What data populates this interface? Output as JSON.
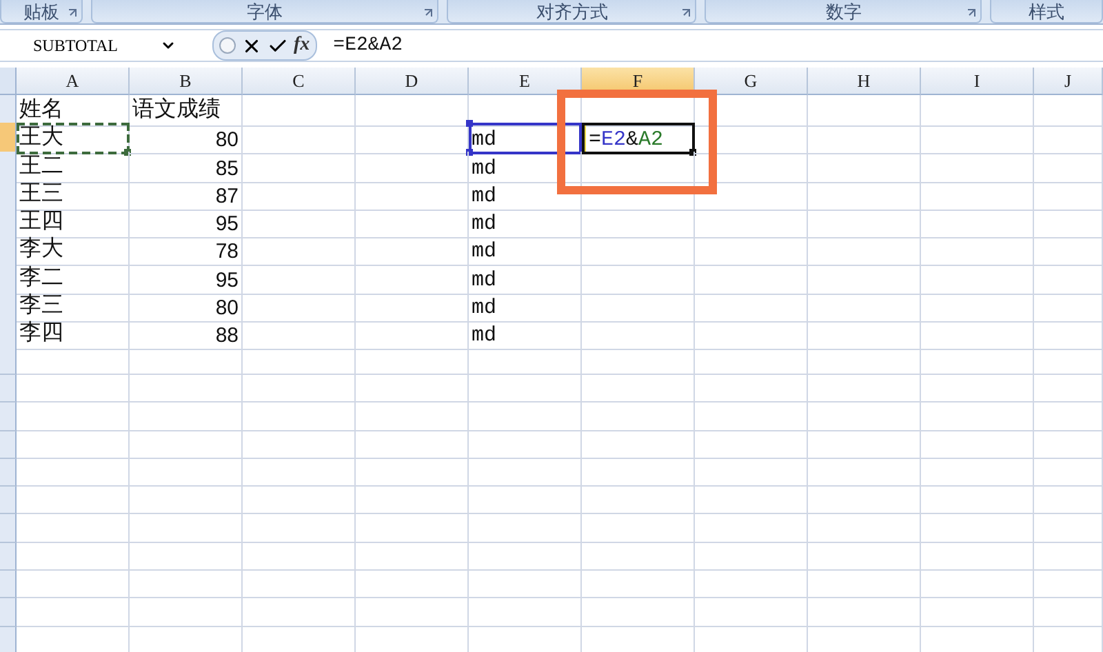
{
  "ribbon_groups": [
    "贴板",
    "字体",
    "对齐方式",
    "数字",
    "样式"
  ],
  "formula_bar": {
    "name_box": "SUBTOTAL",
    "function_button": "fx",
    "formula": "=E2&A2"
  },
  "columns": [
    {
      "label": "A",
      "selected": false
    },
    {
      "label": "B",
      "selected": false
    },
    {
      "label": "C",
      "selected": false
    },
    {
      "label": "D",
      "selected": false
    },
    {
      "label": "E",
      "selected": false
    },
    {
      "label": "F",
      "selected": true
    },
    {
      "label": "G",
      "selected": false
    },
    {
      "label": "H",
      "selected": false
    },
    {
      "label": "I",
      "selected": false
    },
    {
      "label": "J",
      "selected": false
    }
  ],
  "rows": [
    {
      "selected": false,
      "cells": {
        "A": {
          "kind": "text",
          "text": "姓名",
          "copy_marquee": false,
          "reference_box": false
        },
        "B": {
          "kind": "text",
          "text": "语文成绩",
          "copy_marquee": false,
          "reference_box": false
        }
      }
    },
    {
      "selected": true,
      "cells": {
        "A": {
          "kind": "text",
          "text": "王大",
          "copy_marquee": true,
          "reference_box": false
        },
        "B": {
          "kind": "number",
          "text": "80",
          "copy_marquee": false,
          "reference_box": false
        },
        "E": {
          "kind": "code",
          "text": "md",
          "copy_marquee": false,
          "reference_box": true
        },
        "F": {
          "kind": "formula",
          "copy_marquee": false,
          "reference_box": false,
          "parts": [
            {
              "text": "=",
              "color": "#111111"
            },
            {
              "text": "E2",
              "color": "#3535c8"
            },
            {
              "text": "&",
              "color": "#111111"
            },
            {
              "text": "A2",
              "color": "#2a7a2a"
            }
          ]
        }
      }
    },
    {
      "selected": false,
      "cells": {
        "A": {
          "kind": "text",
          "text": "王二",
          "copy_marquee": false,
          "reference_box": false
        },
        "B": {
          "kind": "number",
          "text": "85",
          "copy_marquee": false,
          "reference_box": false
        },
        "E": {
          "kind": "code",
          "text": "md",
          "copy_marquee": false,
          "reference_box": false
        }
      }
    },
    {
      "selected": false,
      "cells": {
        "A": {
          "kind": "text",
          "text": "王三",
          "copy_marquee": false,
          "reference_box": false
        },
        "B": {
          "kind": "number",
          "text": "87",
          "copy_marquee": false,
          "reference_box": false
        },
        "E": {
          "kind": "code",
          "text": "md",
          "copy_marquee": false,
          "reference_box": false
        }
      }
    },
    {
      "selected": false,
      "cells": {
        "A": {
          "kind": "text",
          "text": "王四",
          "copy_marquee": false,
          "reference_box": false
        },
        "B": {
          "kind": "number",
          "text": "95",
          "copy_marquee": false,
          "reference_box": false
        },
        "E": {
          "kind": "code",
          "text": "md",
          "copy_marquee": false,
          "reference_box": false
        }
      }
    },
    {
      "selected": false,
      "cells": {
        "A": {
          "kind": "text",
          "text": "李大",
          "copy_marquee": false,
          "reference_box": false
        },
        "B": {
          "kind": "number",
          "text": "78",
          "copy_marquee": false,
          "reference_box": false
        },
        "E": {
          "kind": "code",
          "text": "md",
          "copy_marquee": false,
          "reference_box": false
        }
      }
    },
    {
      "selected": false,
      "cells": {
        "A": {
          "kind": "text",
          "text": "李二",
          "copy_marquee": false,
          "reference_box": false
        },
        "B": {
          "kind": "number",
          "text": "95",
          "copy_marquee": false,
          "reference_box": false
        },
        "E": {
          "kind": "code",
          "text": "md",
          "copy_marquee": false,
          "reference_box": false
        }
      }
    },
    {
      "selected": false,
      "cells": {
        "A": {
          "kind": "text",
          "text": "李三",
          "copy_marquee": false,
          "reference_box": false
        },
        "B": {
          "kind": "number",
          "text": "80",
          "copy_marquee": false,
          "reference_box": false
        },
        "E": {
          "kind": "code",
          "text": "md",
          "copy_marquee": false,
          "reference_box": false
        }
      }
    },
    {
      "selected": false,
      "cells": {
        "A": {
          "kind": "text",
          "text": "李四",
          "copy_marquee": false,
          "reference_box": false
        },
        "B": {
          "kind": "number",
          "text": "88",
          "copy_marquee": false,
          "reference_box": false
        },
        "E": {
          "kind": "code",
          "text": "md",
          "copy_marquee": false,
          "reference_box": false
        }
      }
    }
  ],
  "annotation": {
    "kind": "box"
  }
}
